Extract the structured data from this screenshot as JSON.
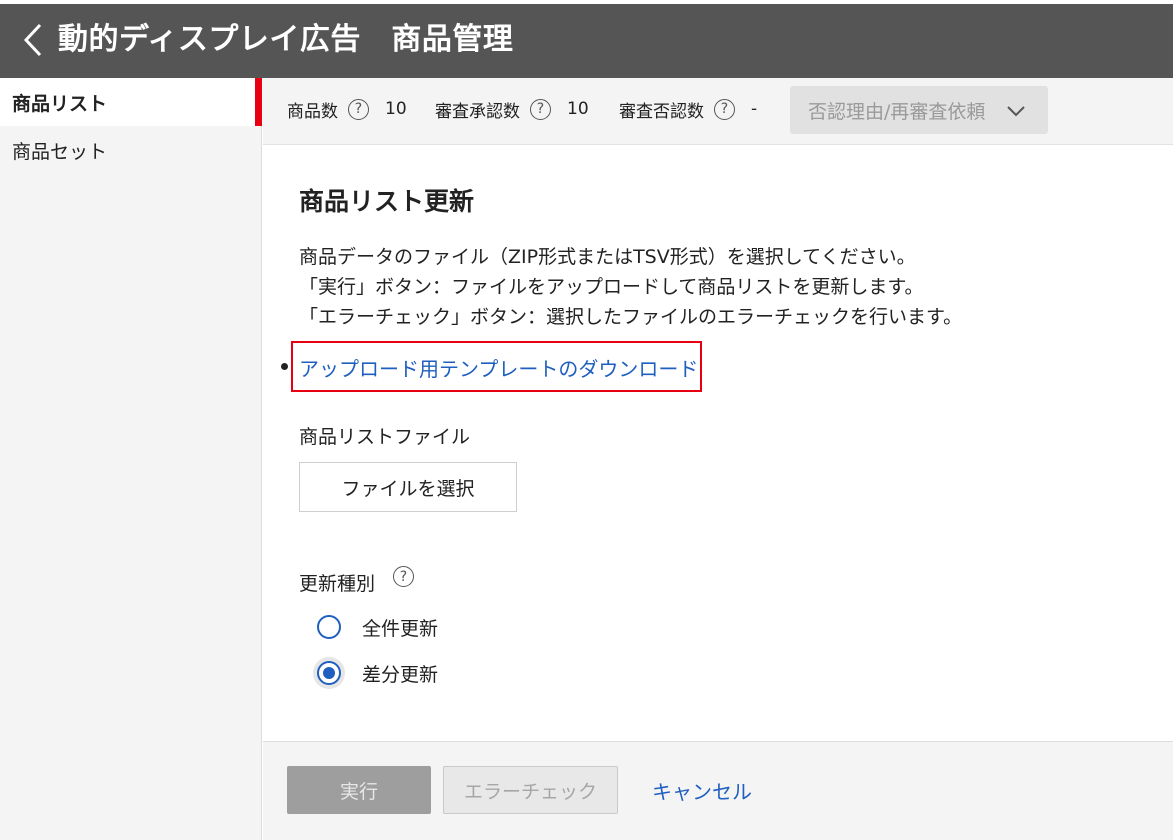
{
  "header": {
    "title": "動的ディスプレイ広告　商品管理",
    "back_icon": "chevron-left-icon"
  },
  "sidebar": {
    "items": [
      {
        "label": "商品リスト",
        "active": true
      },
      {
        "label": "商品セット",
        "active": false
      }
    ],
    "accent_color": "#e60012"
  },
  "stats": {
    "product_count_label": "商品数",
    "product_count_value": "10",
    "approved_label": "審査承認数",
    "approved_value": "10",
    "rejected_label": "審査否認数",
    "rejected_value": "-",
    "help_icon_glyph": "?",
    "reason_button_label": "否認理由/再審査依頼"
  },
  "main": {
    "heading": "商品リスト更新",
    "description_lines": [
      "商品データのファイル（ZIP形式またはTSV形式）を選択してください。",
      "「実行」ボタン：ファイルをアップロードして商品リストを更新します。",
      "「エラーチェック」ボタン：選択したファイルのエラーチェックを行います。"
    ],
    "template_download_link": "アップロード用テンプレートのダウンロード",
    "file_label": "商品リストファイル",
    "file_button_label": "ファイルを選択",
    "update_type_label": "更新種別",
    "update_options": [
      {
        "label": "全件更新",
        "selected": false
      },
      {
        "label": "差分更新",
        "selected": true
      }
    ]
  },
  "footer": {
    "run_label": "実行",
    "error_check_label": "エラーチェック",
    "cancel_label": "キャンセル"
  },
  "colors": {
    "header_bg": "#555555",
    "link": "#1f5fbf",
    "highlight_border": "#e60012",
    "disabled_button": "#9e9e9e"
  }
}
